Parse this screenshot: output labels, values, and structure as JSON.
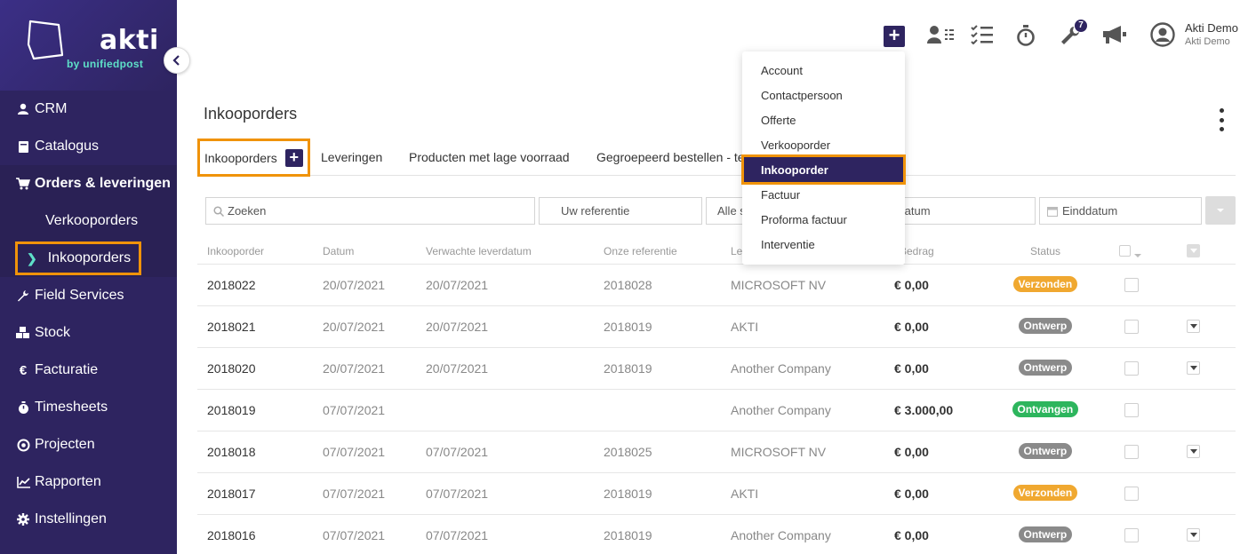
{
  "logo": {
    "name": "akti",
    "tagline": "by unifiedpost"
  },
  "sidebar": {
    "items": [
      {
        "label": "CRM",
        "icon": "user-icon"
      },
      {
        "label": "Catalogus",
        "icon": "book-icon"
      },
      {
        "label": "Orders & leveringen",
        "icon": "cart-icon"
      },
      {
        "label": "Verkooporders"
      },
      {
        "label": "Inkooporders"
      },
      {
        "label": "Field Services",
        "icon": "wrench-icon"
      },
      {
        "label": "Stock",
        "icon": "boxes-icon"
      },
      {
        "label": "Facturatie",
        "icon": "euro-icon"
      },
      {
        "label": "Timesheets",
        "icon": "stopwatch-icon"
      },
      {
        "label": "Projecten",
        "icon": "target-icon"
      },
      {
        "label": "Rapporten",
        "icon": "chart-icon"
      },
      {
        "label": "Instellingen",
        "icon": "gear-icon"
      }
    ]
  },
  "topbar": {
    "notification_count": "7",
    "user_name": "Akti Demo",
    "user_company": "Akti Demo"
  },
  "dropdown": {
    "items": [
      "Account",
      "Contactpersoon",
      "Offerte",
      "Verkooporder",
      "Inkooporder",
      "Factuur",
      "Proforma factuur",
      "Interventie"
    ]
  },
  "page": {
    "title": "Inkooporders",
    "tabs": [
      "Inkooporders",
      "Leveringen",
      "Producten met lage voorraad",
      "Gegroepeerd bestellen - te"
    ]
  },
  "filters": {
    "search_placeholder": "Zoeken",
    "reference_placeholder": "Uw referentie",
    "status_value": "Alle s",
    "start_date_placeholder": "Startdatum",
    "end_date_placeholder": "Einddatum"
  },
  "table": {
    "headers": [
      "Inkooporder",
      "Datum",
      "Verwachte leverdatum",
      "Onze referentie",
      "Le",
      "Bedrag",
      "Status"
    ],
    "rows": [
      {
        "id": "2018022",
        "date": "20/07/2021",
        "delivery": "20/07/2021",
        "ref": "2018028",
        "supplier": "MICROSOFT NV",
        "amount": "€ 0,00",
        "status": "Verzonden"
      },
      {
        "id": "2018021",
        "date": "20/07/2021",
        "delivery": "20/07/2021",
        "ref": "2018019",
        "supplier": "AKTI",
        "amount": "€ 0,00",
        "status": "Ontwerp"
      },
      {
        "id": "2018020",
        "date": "20/07/2021",
        "delivery": "20/07/2021",
        "ref": "2018019",
        "supplier": "Another Company",
        "amount": "€ 0,00",
        "status": "Ontwerp"
      },
      {
        "id": "2018019",
        "date": "07/07/2021",
        "delivery": "",
        "ref": "",
        "supplier": "Another Company",
        "amount": "€ 3.000,00",
        "status": "Ontvangen"
      },
      {
        "id": "2018018",
        "date": "07/07/2021",
        "delivery": "07/07/2021",
        "ref": "2018025",
        "supplier": "MICROSOFT NV",
        "amount": "€ 0,00",
        "status": "Ontwerp"
      },
      {
        "id": "2018017",
        "date": "07/07/2021",
        "delivery": "07/07/2021",
        "ref": "2018019",
        "supplier": "AKTI",
        "amount": "€ 0,00",
        "status": "Verzonden"
      },
      {
        "id": "2018016",
        "date": "07/07/2021",
        "delivery": "07/07/2021",
        "ref": "2018019",
        "supplier": "Another Company",
        "amount": "€ 0,00",
        "status": "Ontwerp"
      }
    ]
  },
  "colors": {
    "brand": "#2e2460",
    "accent": "#5ee0c8",
    "highlight": "#f0930a",
    "status_verzonden": "#f0a830",
    "status_ontwerp": "#8a8a8a",
    "status_ontvangen": "#2db55d"
  }
}
